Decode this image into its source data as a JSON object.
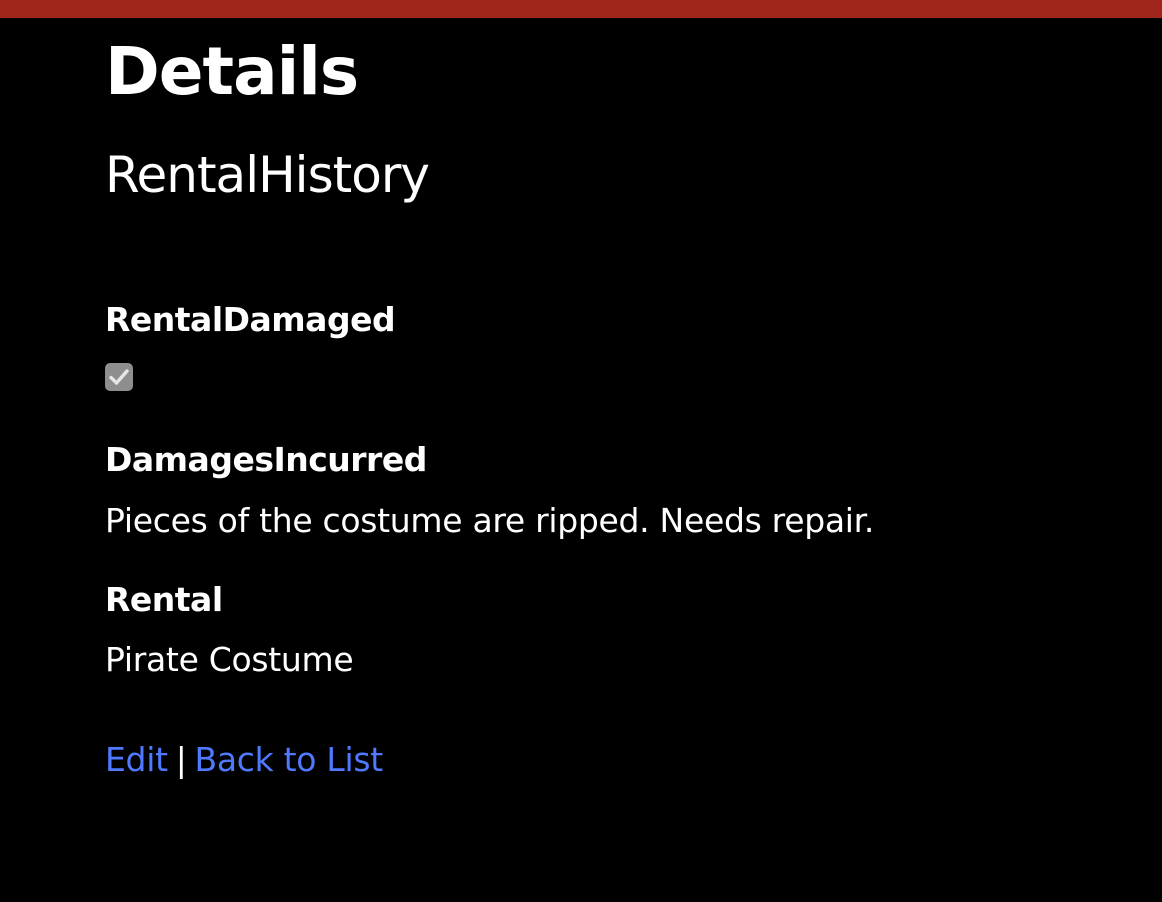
{
  "page": {
    "heading": "Details",
    "entity": "RentalHistory"
  },
  "fields": {
    "rental_damaged": {
      "label": "RentalDamaged",
      "checked": true
    },
    "damages_incurred": {
      "label": "DamagesIncurred",
      "value": "Pieces of the costume are ripped. Needs repair."
    },
    "rental": {
      "label": "Rental",
      "value": "Pirate Costume"
    }
  },
  "actions": {
    "edit_label": "Edit",
    "separator": "|",
    "back_label": "Back to List"
  },
  "colors": {
    "topbar": "#a0261c",
    "background": "#000000",
    "link": "#4f79ff",
    "checkbox": "#8e8e8e"
  }
}
